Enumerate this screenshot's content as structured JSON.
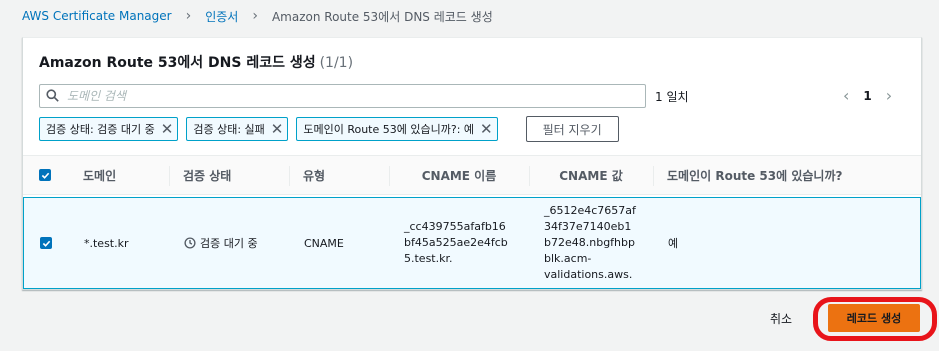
{
  "breadcrumb": {
    "root": "AWS Certificate Manager",
    "certificates": "인증서",
    "current": "Amazon Route 53에서 DNS 레코드 생성"
  },
  "panel": {
    "title": "Amazon Route 53에서 DNS 레코드 생성",
    "count": "(1/1)"
  },
  "search": {
    "placeholder": "도메인 검색",
    "match_count": "1 일치"
  },
  "pagination": {
    "current_page": "1"
  },
  "filters": {
    "tokens": [
      "검증 상태: 검증 대기 중",
      "검증 상태: 실패",
      "도메인이 Route 53에 있습니까?: 예"
    ],
    "clear_label": "필터 지우기"
  },
  "table": {
    "headers": [
      "도메인",
      "검증 상태",
      "유형",
      "CNAME 이름",
      "CNAME 값",
      "도메인이 Route 53에 있습니까?"
    ],
    "rows": [
      {
        "domain": "*.test.kr",
        "status": "검증 대기 중",
        "type": "CNAME",
        "cname_name": [
          "_cc439755afafb16",
          "bf45a525ae2e4fcb",
          "5.test.kr."
        ],
        "cname_value": [
          "_6512e4c7657af",
          "34f37e7140eb1",
          "b72e48.nbgfhbp",
          "blk.acm-",
          "validations.aws."
        ],
        "in_route53": "예"
      }
    ]
  },
  "footer": {
    "cancel_label": "취소",
    "create_label": "레코드 생성"
  },
  "colors": {
    "primary": "#ec7211",
    "link": "#0073bb",
    "selected_border": "#00a1c9",
    "annotation": "#e8141a"
  }
}
